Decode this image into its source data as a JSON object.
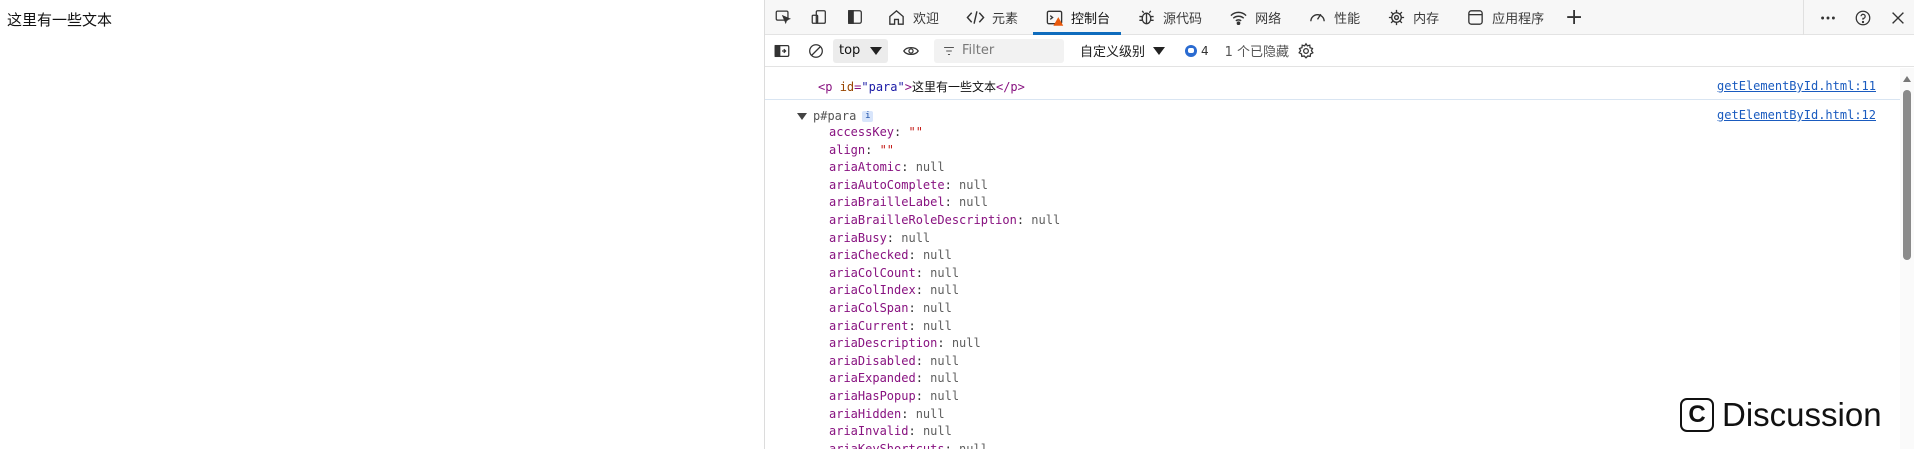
{
  "page": {
    "text": "这里有一些文本"
  },
  "devtools": {
    "tabs": [
      {
        "label": "欢迎",
        "icon": "home-icon"
      },
      {
        "label": "元素",
        "icon": "code-icon"
      },
      {
        "label": "控制台",
        "icon": "console-icon",
        "active": true
      },
      {
        "label": "源代码",
        "icon": "bug-icon"
      },
      {
        "label": "网络",
        "icon": "wifi-icon"
      },
      {
        "label": "性能",
        "icon": "gauge-icon"
      },
      {
        "label": "内存",
        "icon": "chip-icon"
      },
      {
        "label": "应用程序",
        "icon": "app-icon"
      }
    ],
    "accent_color": "#0f6cbd"
  },
  "toolbar": {
    "context": "top",
    "filter_placeholder": "Filter",
    "levels": "自定义级别",
    "issues_count": "4",
    "hidden": "1 个已隐藏"
  },
  "console": {
    "log1": {
      "open_tag": "<p",
      "attr_name": "id",
      "attr_value": "\"para\"",
      "close_bracket": ">",
      "text": "这里有一些文本",
      "end_tag": "</p>",
      "source": "getElementById.html:11"
    },
    "log2": {
      "label": "p#para",
      "info": "i",
      "source": "getElementById.html:12",
      "props": [
        {
          "key": "accessKey",
          "value": "\"\""
        },
        {
          "key": "align",
          "value": "\"\""
        },
        {
          "key": "ariaAtomic",
          "value": "null"
        },
        {
          "key": "ariaAutoComplete",
          "value": "null"
        },
        {
          "key": "ariaBrailleLabel",
          "value": "null"
        },
        {
          "key": "ariaBrailleRoleDescription",
          "value": "null"
        },
        {
          "key": "ariaBusy",
          "value": "null"
        },
        {
          "key": "ariaChecked",
          "value": "null"
        },
        {
          "key": "ariaColCount",
          "value": "null"
        },
        {
          "key": "ariaColIndex",
          "value": "null"
        },
        {
          "key": "ariaColSpan",
          "value": "null"
        },
        {
          "key": "ariaCurrent",
          "value": "null"
        },
        {
          "key": "ariaDescription",
          "value": "null"
        },
        {
          "key": "ariaDisabled",
          "value": "null"
        },
        {
          "key": "ariaExpanded",
          "value": "null"
        },
        {
          "key": "ariaHasPopup",
          "value": "null"
        },
        {
          "key": "ariaHidden",
          "value": "null"
        },
        {
          "key": "ariaInvalid",
          "value": "null"
        },
        {
          "key": "ariaKeyShortcuts",
          "value": "null"
        }
      ]
    }
  },
  "overlay": {
    "discussion": "Discussion",
    "badge": "C"
  }
}
